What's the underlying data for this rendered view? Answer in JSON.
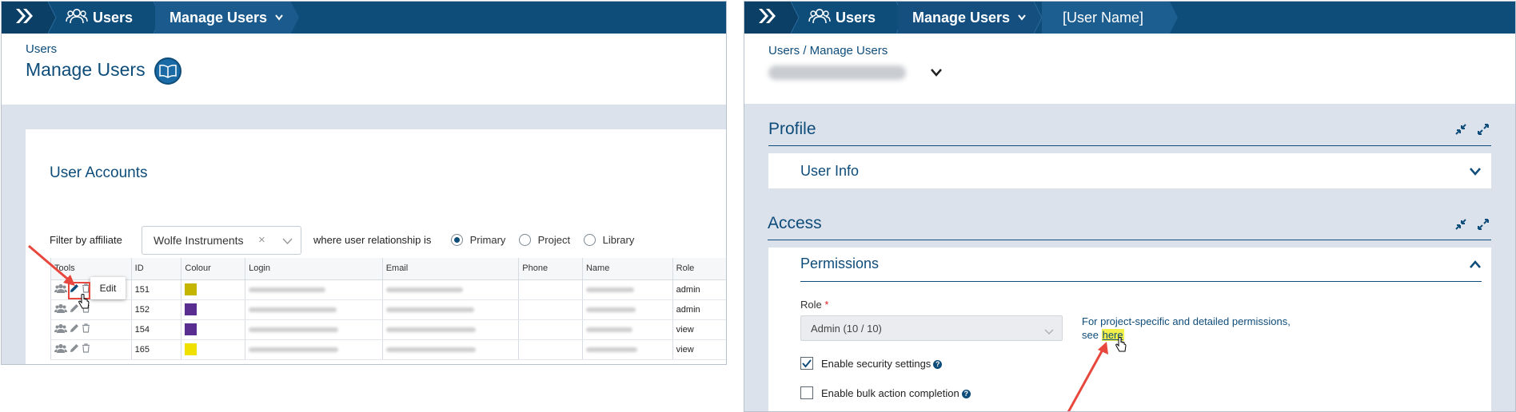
{
  "left": {
    "nav": {
      "users": "Users",
      "manage_users": "Manage Users"
    },
    "subcrumb": "Users",
    "title": "Manage Users",
    "section_title": "User Accounts",
    "filter": {
      "label": "Filter by affiliate",
      "value": "Wolfe Instruments",
      "relationship_label": "where user relationship is",
      "options": [
        "Primary",
        "Project",
        "Library"
      ],
      "selected": "Primary"
    },
    "table": {
      "headers": [
        "Tools",
        "ID",
        "Colour",
        "Login",
        "Email",
        "Phone",
        "Name",
        "Role"
      ],
      "rows": [
        {
          "id": "151",
          "colour": "#c4b600",
          "role": "admin"
        },
        {
          "id": "152",
          "colour": "#5a2e91",
          "role": "admin"
        },
        {
          "id": "154",
          "colour": "#5a2e91",
          "role": "view"
        },
        {
          "id": "165",
          "colour": "#f0e000",
          "role": "view"
        }
      ]
    },
    "tooltip": "Edit"
  },
  "right": {
    "nav": {
      "users": "Users",
      "manage_users": "Manage Users",
      "user_name": "[User Name]"
    },
    "subcrumb": "Users / Manage Users",
    "sections": {
      "profile": "Profile",
      "user_info": "User Info",
      "access": "Access",
      "permissions": "Permissions"
    },
    "role": {
      "label": "Role",
      "required_mark": "*",
      "value": "Admin (10 / 10)"
    },
    "note": {
      "line1": "For project-specific and detailed permissions,",
      "see": "see",
      "link": "here"
    },
    "checks": {
      "security": {
        "label": "Enable security settings",
        "checked": true
      },
      "bulk": {
        "label": "Enable bulk action completion",
        "checked": false
      }
    }
  },
  "colors": {
    "nav": "#0e4c7a",
    "accent_blue": "#0e4c7a",
    "annotation_red": "#e8473d",
    "highlight": "#f4f04a"
  }
}
